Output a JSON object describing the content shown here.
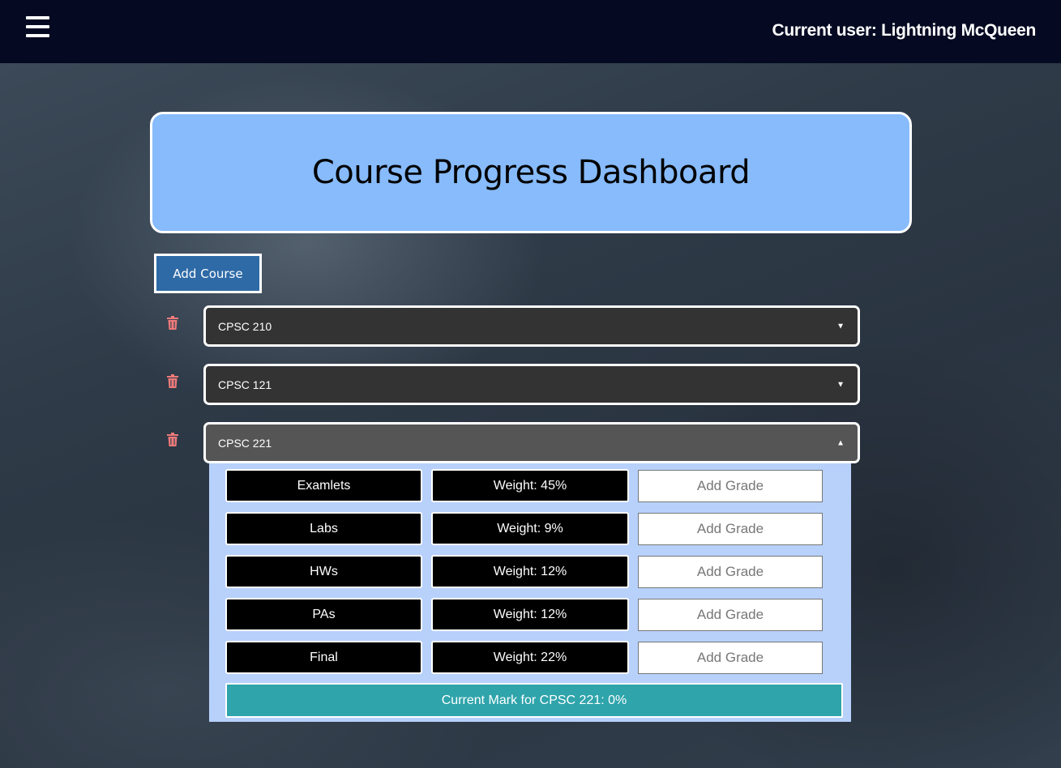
{
  "header": {
    "menu_icon": "hamburger-menu-icon",
    "current_user": "Current user: Lightning McQueen"
  },
  "dashboard": {
    "title": "Course Progress Dashboard",
    "add_course_label": "Add Course"
  },
  "courses": [
    {
      "name": "CPSC 210",
      "expanded": false,
      "arrow": "▼"
    },
    {
      "name": "CPSC 121",
      "expanded": false,
      "arrow": "▼"
    },
    {
      "name": "CPSC 221",
      "expanded": true,
      "arrow": "▲"
    }
  ],
  "components": [
    {
      "name": "Examlets",
      "weight": "Weight: 45%",
      "grade_placeholder": "Add Grade"
    },
    {
      "name": "Labs",
      "weight": "Weight: 9%",
      "grade_placeholder": "Add Grade"
    },
    {
      "name": "HWs",
      "weight": "Weight: 12%",
      "grade_placeholder": "Add Grade"
    },
    {
      "name": "PAs",
      "weight": "Weight: 12%",
      "grade_placeholder": "Add Grade"
    },
    {
      "name": "Final",
      "weight": "Weight: 22%",
      "grade_placeholder": "Add Grade"
    }
  ],
  "current_mark": "Current Mark for CPSC 221: 0%",
  "colors": {
    "topbar": "#050a22",
    "header_card": "#87bbfb",
    "add_course": "#2e6aa6",
    "trash": "#f07a7a",
    "panel": "#b7d1fb",
    "mark_bar": "#2fa4ab"
  }
}
